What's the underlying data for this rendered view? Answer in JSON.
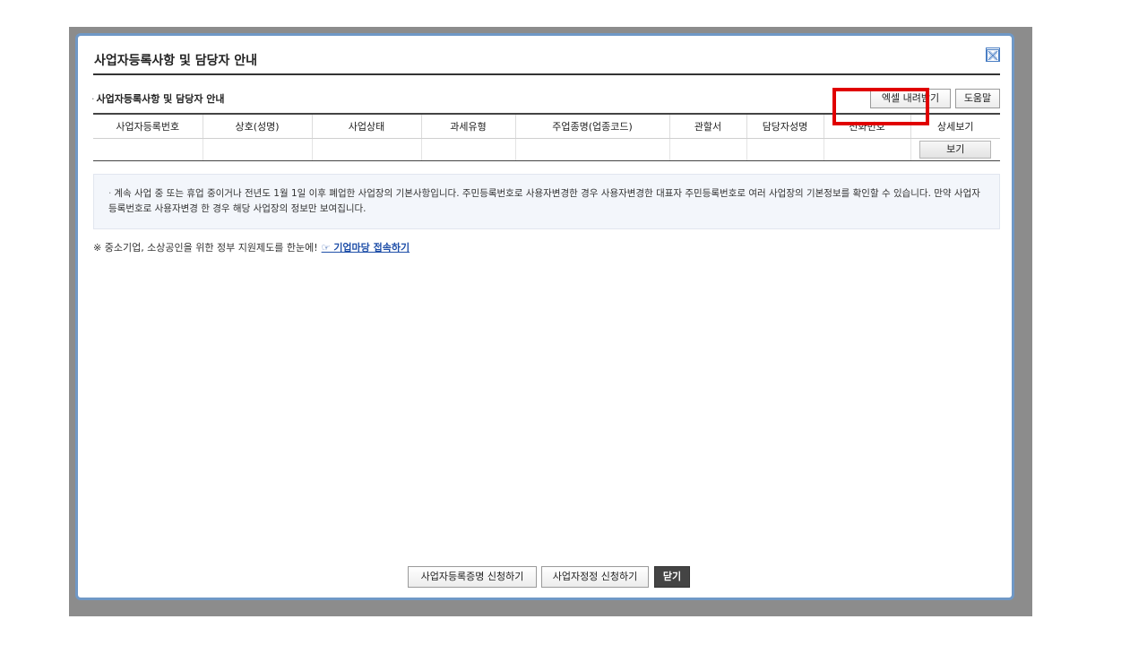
{
  "dialog": {
    "title": "사업자등록사항 및 담당자 안내",
    "close_icon": "close-icon"
  },
  "section": {
    "label": "사업자등록사항 및 담당자 안내",
    "excel_button": "엑셀 내려받기",
    "help_button": "도움말"
  },
  "table": {
    "headers": [
      "사업자등록번호",
      "상호(성명)",
      "사업상태",
      "과세유형",
      "주업종명(업종코드)",
      "관할서",
      "담당자성명",
      "전화번호",
      "상세보기"
    ],
    "row": {
      "view_button": "보기"
    }
  },
  "info": {
    "bullet": "·",
    "text": "계속 사업 중 또는 휴업 중이거나 전년도 1월 1일 이후 폐업한 사업장의 기본사항입니다. 주민등록번호로 사용자변경한 경우 사용자변경한 대표자 주민등록번호로 여러 사업장의 기본정보를 확인할 수 있습니다. 만약 사업자등록번호로 사용자변경 한 경우 해당 사업장의 정보만 보여집니다."
  },
  "notice": {
    "text": "※ 중소기업, 소상공인을 위한 정부 지원제도를 한눈에!",
    "link": "☞ 기업마당 접속하기"
  },
  "footer": {
    "apply_cert_button": "사업자등록증명 신청하기",
    "apply_correction_button": "사업자정정 신청하기",
    "close_button": "닫기"
  },
  "colors": {
    "dialog_border": "#6f98c6",
    "highlight": "#e00000",
    "link": "#1f4fa8",
    "info_bg": "#f3f6fb"
  }
}
